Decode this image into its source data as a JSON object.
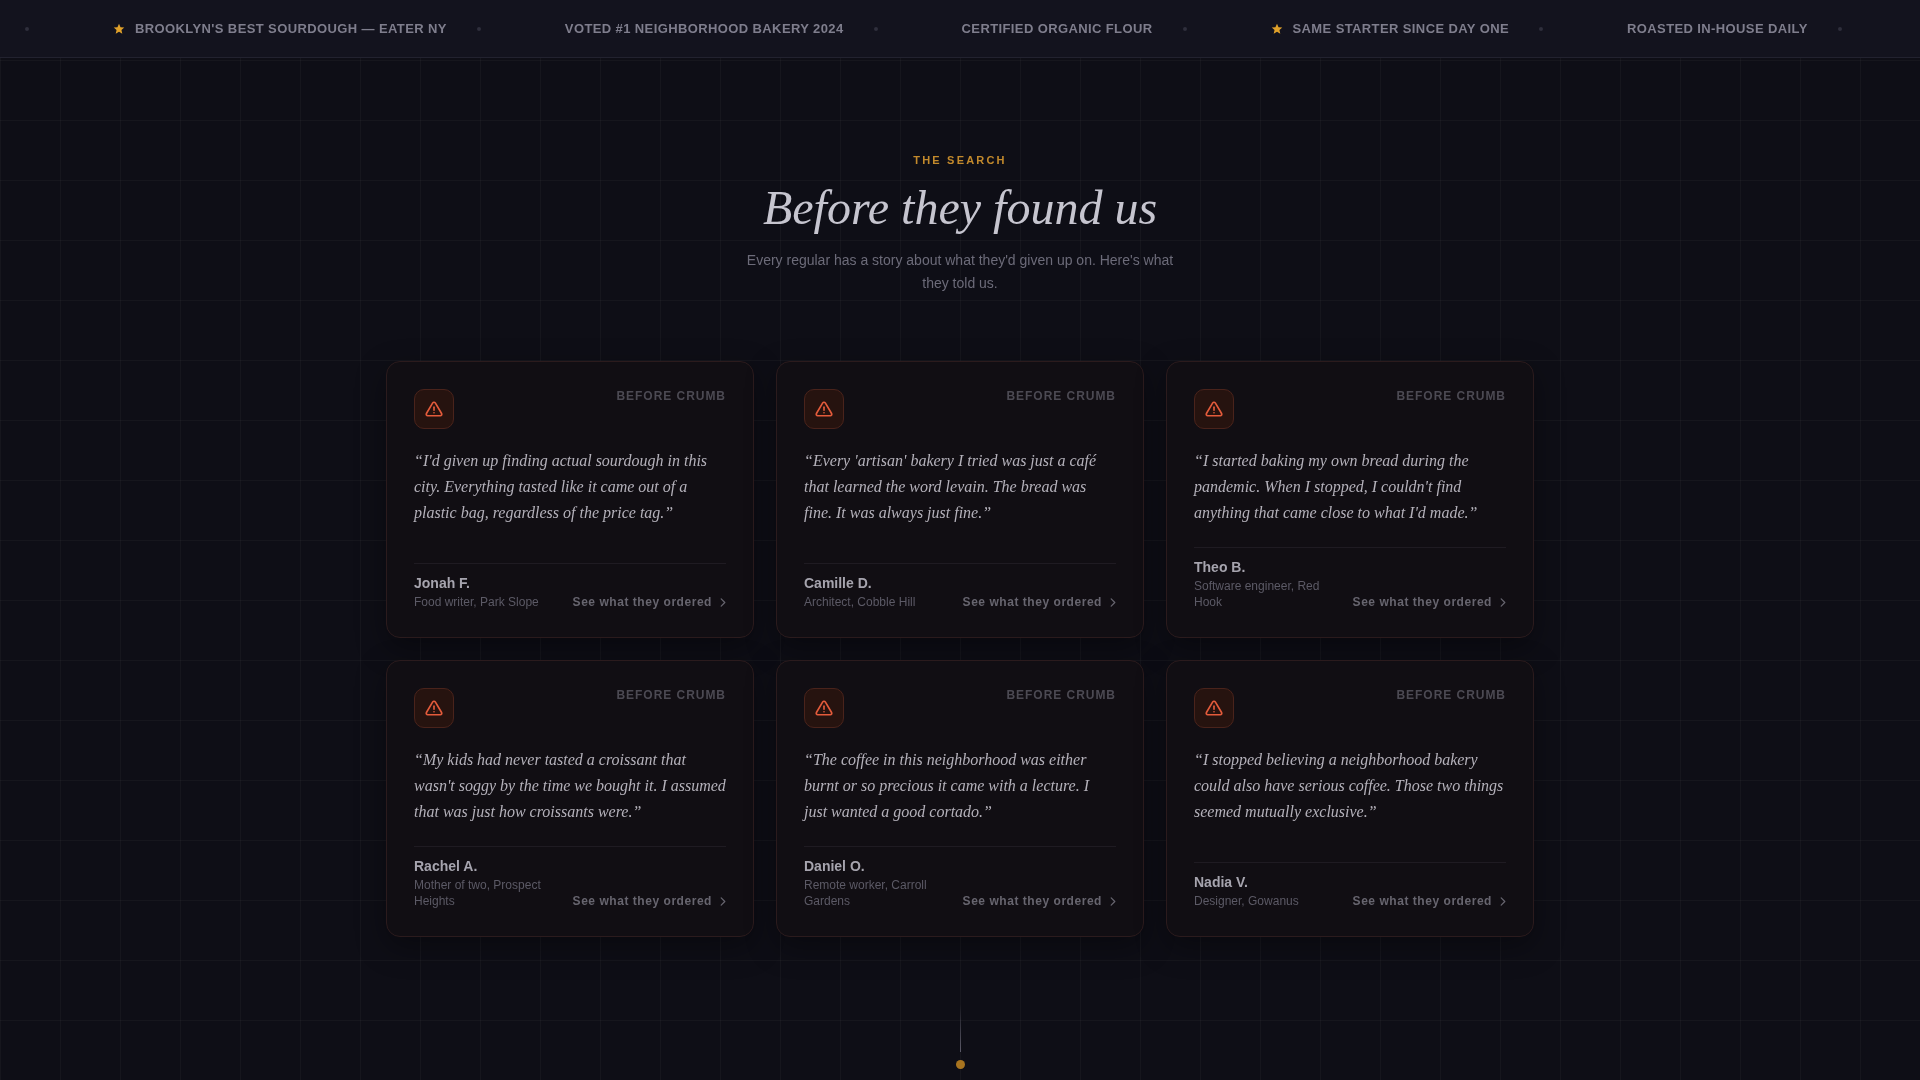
{
  "ticker": [
    {
      "text": "BROOKLYN'S BEST SOURDOUGH — EATER NY",
      "starred": true
    },
    {
      "text": "VOTED #1 NEIGHBORHOOD BAKERY 2024",
      "starred": false
    },
    {
      "text": "CERTIFIED ORGANIC FLOUR",
      "starred": false
    },
    {
      "text": "SAME STARTER SINCE DAY ONE",
      "starred": true
    },
    {
      "text": "ROASTED IN-HOUSE DAILY",
      "starred": false
    }
  ],
  "section": {
    "eyebrow": "THE SEARCH",
    "title": "Before they found us",
    "subtitle": "Every regular has a story about what they'd given up on. Here's what they told us."
  },
  "testimonials": [
    {
      "tag": "BEFORE CRUMB",
      "quote": "“I'd given up finding actual sourdough in this city. Everything tasted like it came out of a plastic bag, regardless of the price tag.”",
      "name": "Jonah F.",
      "role": "Food writer, Park Slope",
      "link": "See what they ordered"
    },
    {
      "tag": "BEFORE CRUMB",
      "quote": "“Every 'artisan' bakery I tried was just a café that learned the word levain. The bread was fine. It was always just fine.”",
      "name": "Camille D.",
      "role": "Architect, Cobble Hill",
      "link": "See what they ordered"
    },
    {
      "tag": "BEFORE CRUMB",
      "quote": "“I started baking my own bread during the pandemic. When I stopped, I couldn't find anything that came close to what I'd made.”",
      "name": "Theo B.",
      "role": "Software engineer, Red Hook",
      "link": "See what they ordered"
    },
    {
      "tag": "BEFORE CRUMB",
      "quote": "“My kids had never tasted a croissant that wasn't soggy by the time we bought it. I assumed that was just how croissants were.”",
      "name": "Rachel A.",
      "role": "Mother of two, Prospect Heights",
      "link": "See what they ordered"
    },
    {
      "tag": "BEFORE CRUMB",
      "quote": "“The coffee in this neighborhood was either burnt or so precious it came with a lecture. I just wanted a good cortado.”",
      "name": "Daniel O.",
      "role": "Remote worker, Carroll Gardens",
      "link": "See what they ordered"
    },
    {
      "tag": "BEFORE CRUMB",
      "quote": "“I stopped believing a neighborhood bakery could also have serious coffee. Those two things seemed mutually exclusive.”",
      "name": "Nadia V.",
      "role": "Designer, Gowanus",
      "link": "See what they ordered"
    }
  ]
}
